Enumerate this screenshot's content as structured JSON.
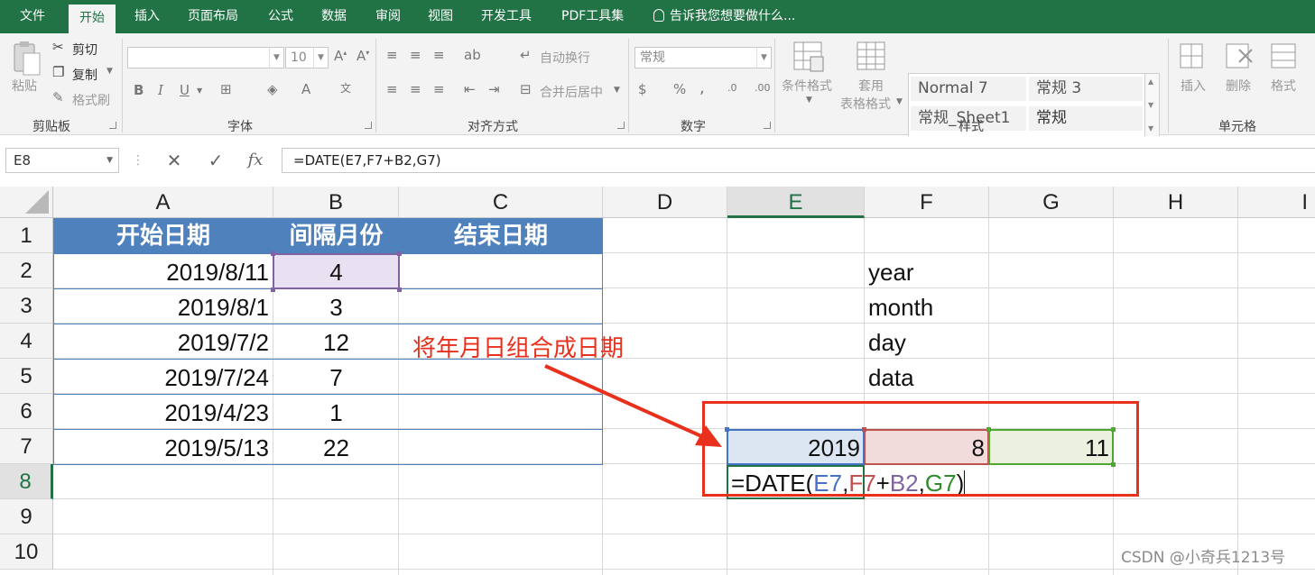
{
  "tabs": [
    {
      "label": "文件"
    },
    {
      "label": "开始"
    },
    {
      "label": "插入"
    },
    {
      "label": "页面布局"
    },
    {
      "label": "公式"
    },
    {
      "label": "数据"
    },
    {
      "label": "审阅"
    },
    {
      "label": "视图"
    },
    {
      "label": "开发工具"
    },
    {
      "label": "PDF工具集"
    }
  ],
  "tell_me": "告诉我您想要做什么...",
  "ribbon": {
    "clipboard": {
      "paste": "粘贴",
      "cut": "剪切",
      "copy": "复制",
      "format_painter": "格式刷",
      "label": "剪贴板"
    },
    "font": {
      "font_size": "10",
      "label": "字体",
      "bold": "B",
      "italic": "I",
      "underline": "U"
    },
    "alignment": {
      "wrap": "自动换行",
      "merge": "合并后居中",
      "label": "对齐方式"
    },
    "number": {
      "format": "常规",
      "label": "数字",
      "percent": "%",
      "comma": ","
    },
    "styles": {
      "conditional": "条件格式",
      "table_format_1": "套用",
      "table_format_2": "表格格式",
      "label": "样式",
      "gallery": [
        "Normal 7",
        "常规 3",
        "常规_Sheet1",
        "常规"
      ]
    },
    "cells": {
      "insert": "插入",
      "delete": "删除",
      "format": "格式",
      "label": "单元格"
    }
  },
  "formula_bar": {
    "name_box": "E8",
    "fx": "fx",
    "formula": "=DATE(E7,F7+B2,G7)"
  },
  "columns": [
    "A",
    "B",
    "C",
    "D",
    "E",
    "F",
    "G",
    "H",
    "I"
  ],
  "rows": [
    "1",
    "2",
    "3",
    "4",
    "5",
    "6",
    "7",
    "8",
    "9",
    "10"
  ],
  "table": {
    "headers": [
      "开始日期",
      "间隔月份",
      "结束日期"
    ],
    "rows": [
      {
        "start": "2019/8/11",
        "months": "4"
      },
      {
        "start": "2019/8/1",
        "months": "3"
      },
      {
        "start": "2019/7/2",
        "months": "12"
      },
      {
        "start": "2019/7/24",
        "months": "7"
      },
      {
        "start": "2019/4/23",
        "months": "1"
      },
      {
        "start": "2019/5/13",
        "months": "22"
      }
    ]
  },
  "f_labels": [
    "year",
    "month",
    "day",
    "data"
  ],
  "row7": {
    "e": "2019",
    "f": "8",
    "g": "11"
  },
  "edit_formula": {
    "prefix": "=DATE(",
    "arg1": "E7",
    "comma1": ",",
    "arg2": "F7",
    "plus": "+",
    "arg3": "B2",
    "comma2": ",",
    "arg4": "G7",
    "suffix": ")"
  },
  "annotation": "将年月日组合成日期",
  "watermark": "CSDN @小奇兵1213号",
  "colors": {
    "excel_green": "#217346",
    "table_header": "#4f81bd",
    "annotation_red": "#e8301c",
    "e7_blue": "#4472c4",
    "f7_red": "#c0504d",
    "b2_purple": "#8064a2",
    "g7_green": "#4ea72e"
  }
}
